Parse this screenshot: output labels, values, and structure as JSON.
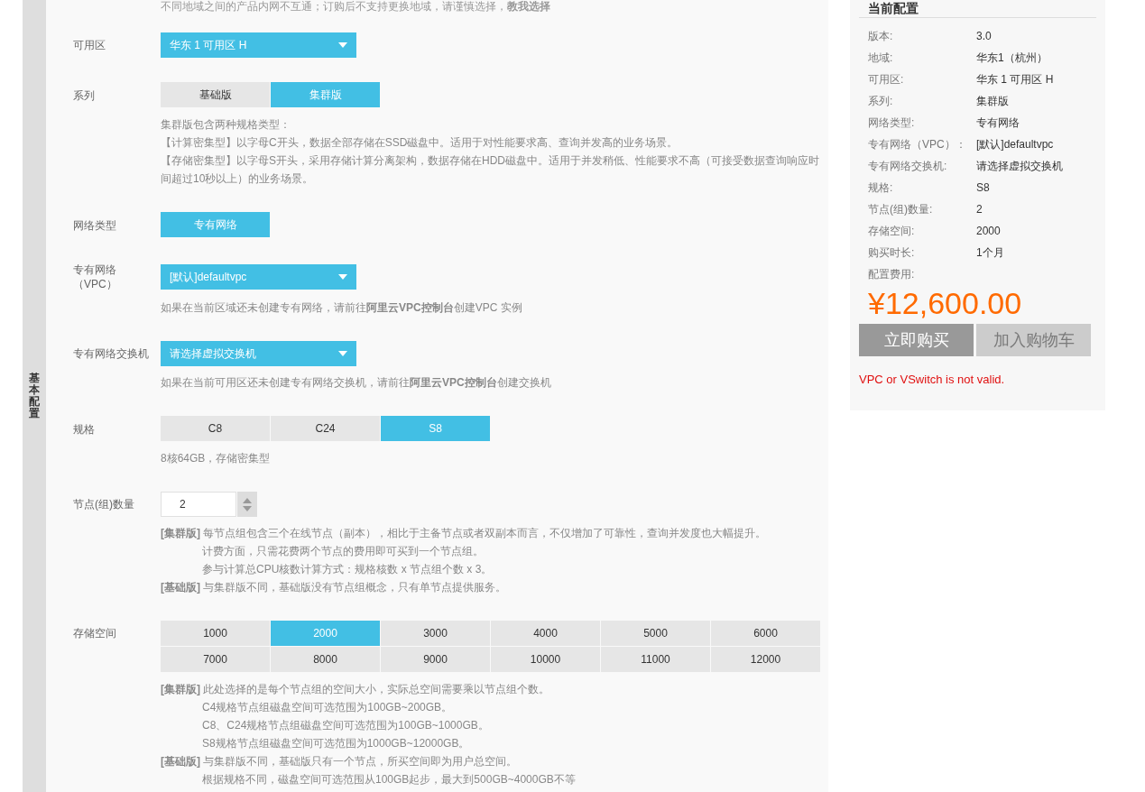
{
  "top_note": "不同地域之间的产品内网不互通；订购后不支持更换地域，请谨慎选择，**教我选择**",
  "side_label": "基本配置",
  "sections": [
    {
      "label": "可用区",
      "kind": "select",
      "value": "华东 1 可用区 H"
    },
    {
      "label": "系列",
      "kind": "segments",
      "options": [
        {
          "label": "基础版",
          "selected": false
        },
        {
          "label": "集群版",
          "selected": true
        }
      ],
      "notes": [
        {
          "text": "集群版包含两种规格类型：",
          "indented": false
        },
        {
          "text": "【计算密集型】以字母C开头，数据全部存储在SSD磁盘中。适用于对性能要求高、查询并发高的业务场景。",
          "indented": false
        },
        {
          "text": "【存储密集型】以字母S开头，采用存储计算分离架构，数据存储在HDD磁盘中。适用于并发稍低、性能要求不高（可接受数据查询响应时间超过10秒以上）的业务场景。",
          "indented": false
        }
      ]
    },
    {
      "label": "网络类型",
      "kind": "segments",
      "options": [
        {
          "label": "专有网络",
          "selected": true
        }
      ]
    },
    {
      "label": "专有网络（VPC）",
      "kind": "select",
      "value": "[默认]defaultvpc",
      "notes": [
        {
          "text": "如果在当前区域还未创建专有网络，请前往**阿里云VPC控制台**创建VPC 实例",
          "indented": false
        }
      ]
    },
    {
      "label": "专有网络交换机",
      "kind": "select",
      "value": "请选择虚拟交换机",
      "notes": [
        {
          "text": "如果在当前可用区还未创建专有网络交换机，请前往**阿里云VPC控制台**创建交换机",
          "indented": false
        }
      ]
    },
    {
      "label": "规格",
      "kind": "segments",
      "options": [
        {
          "label": "C8",
          "selected": false
        },
        {
          "label": "C24",
          "selected": false
        },
        {
          "label": "S8",
          "selected": true
        }
      ],
      "notes": [
        {
          "text": "8核64GB，存储密集型",
          "indented": false
        }
      ]
    },
    {
      "label": "节点(组)数量",
      "kind": "number",
      "value": "2",
      "notes": [
        {
          "text": "**[集群版]** 每节点组包含三个在线节点（副本），相比于主备节点或者双副本而言，不仅增加了可靠性，查询并发度也大幅提升。",
          "indented": false
        },
        {
          "text": "计费方面，只需花费两个节点的费用即可买到一个节点组。",
          "indented": true
        },
        {
          "text": "参与计算总CPU核数计算方式：规格核数 x 节点组个数 x 3。",
          "indented": true
        },
        {
          "text": "**[基础版]** 与集群版不同，基础版没有节点组概念，只有单节点提供服务。",
          "indented": false
        }
      ]
    },
    {
      "label": "存储空间",
      "kind": "segments",
      "options": [
        {
          "label": "1000",
          "selected": false
        },
        {
          "label": "2000",
          "selected": true
        },
        {
          "label": "3000",
          "selected": false
        },
        {
          "label": "4000",
          "selected": false
        },
        {
          "label": "5000",
          "selected": false
        },
        {
          "label": "6000",
          "selected": false
        },
        {
          "label": "7000",
          "selected": false
        },
        {
          "label": "8000",
          "selected": false
        },
        {
          "label": "9000",
          "selected": false
        },
        {
          "label": "10000",
          "selected": false
        },
        {
          "label": "11000",
          "selected": false
        },
        {
          "label": "12000",
          "selected": false
        }
      ],
      "notes": [
        {
          "text": "**[集群版]** 此处选择的是每个节点组的空间大小，实际总空间需要乘以节点组个数。",
          "indented": false
        },
        {
          "text": "C4规格节点组磁盘空间可选范围为100GB~200GB。",
          "indented": true
        },
        {
          "text": "C8、C24规格节点组磁盘空间可选范围为100GB~1000GB。",
          "indented": true
        },
        {
          "text": "S8规格节点组磁盘空间可选范围为1000GB~12000GB。",
          "indented": true
        },
        {
          "text": "**[基础版]** 与集群版不同，基础版只有一个节点，所买空间即为用户总空间。",
          "indented": false
        },
        {
          "text": "根据规格不同，磁盘空间可选范围从100GB起步，最大到500GB~4000GB不等",
          "indented": true
        }
      ]
    }
  ],
  "summary": {
    "title": "当前配置",
    "rows": [
      {
        "label": "版本:",
        "value": "3.0"
      },
      {
        "label": "地域:",
        "value": "华东1（杭州）"
      },
      {
        "label": "可用区:",
        "value": "华东 1 可用区 H"
      },
      {
        "label": "系列:",
        "value": "集群版"
      },
      {
        "label": "网络类型:",
        "value": "专有网络"
      },
      {
        "label": "专有网络（VPC）：",
        "value": "[默认]defaultvpc"
      },
      {
        "label": "专有网络交换机:",
        "value": "请选择虚拟交换机"
      },
      {
        "label": "规格:",
        "value": "S8"
      },
      {
        "label": "节点(组)数量:",
        "value": "2"
      },
      {
        "label": "存储空间:",
        "value": "2000"
      },
      {
        "label": "购买时长:",
        "value": "1个月"
      }
    ],
    "price_label": "配置费用:",
    "price": "¥12,600.00",
    "buttons": [
      {
        "label": "立即购买",
        "disabled": false
      },
      {
        "label": "加入购物车",
        "disabled": true
      }
    ],
    "error": "VPC or VSwitch is not valid."
  }
}
